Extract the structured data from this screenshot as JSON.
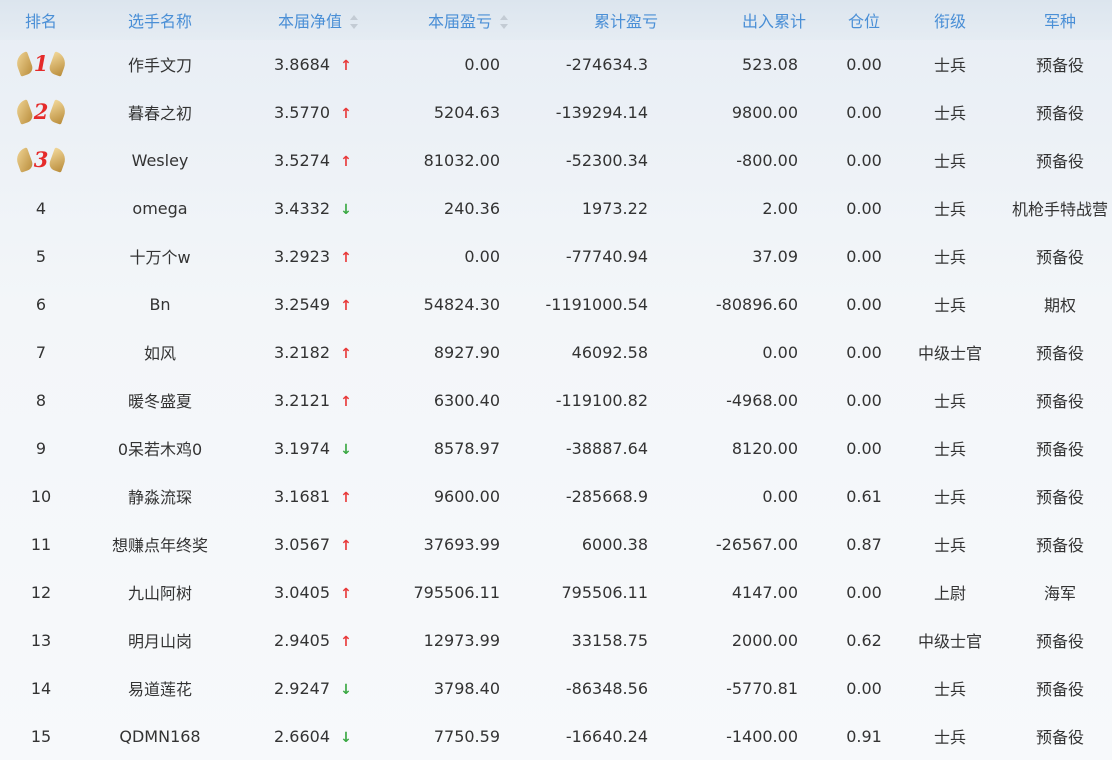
{
  "headers": {
    "rank": "排名",
    "name": "选手名称",
    "nav": "本届净值",
    "pnl": "本届盈亏",
    "cum_pnl": "累计盈亏",
    "flow": "出入累计",
    "position": "仓位",
    "title": "衔级",
    "branch": "军种"
  },
  "colors": {
    "header_text": "#4a8fd6",
    "up_arrow": "#e83a3a",
    "down_arrow": "#3aa843",
    "medal_number": "#e52b2b"
  },
  "rows": [
    {
      "rank": "1",
      "medal": true,
      "name": "作手文刀",
      "nav": "3.8684",
      "trend": "up",
      "pnl": "0.00",
      "cum_pnl": "-274634.3",
      "flow": "523.08",
      "position": "0.00",
      "title": "士兵",
      "branch": "预备役"
    },
    {
      "rank": "2",
      "medal": true,
      "name": "暮春之初",
      "nav": "3.5770",
      "trend": "up",
      "pnl": "5204.63",
      "cum_pnl": "-139294.14",
      "flow": "9800.00",
      "position": "0.00",
      "title": "士兵",
      "branch": "预备役"
    },
    {
      "rank": "3",
      "medal": true,
      "name": "Wesley",
      "nav": "3.5274",
      "trend": "up",
      "pnl": "81032.00",
      "cum_pnl": "-52300.34",
      "flow": "-800.00",
      "position": "0.00",
      "title": "士兵",
      "branch": "预备役"
    },
    {
      "rank": "4",
      "medal": false,
      "name": "omega",
      "nav": "3.4332",
      "trend": "down",
      "pnl": "240.36",
      "cum_pnl": "1973.22",
      "flow": "2.00",
      "position": "0.00",
      "title": "士兵",
      "branch": "机枪手特战营"
    },
    {
      "rank": "5",
      "medal": false,
      "name": "十万个w",
      "nav": "3.2923",
      "trend": "up",
      "pnl": "0.00",
      "cum_pnl": "-77740.94",
      "flow": "37.09",
      "position": "0.00",
      "title": "士兵",
      "branch": "预备役"
    },
    {
      "rank": "6",
      "medal": false,
      "name": "Bn",
      "nav": "3.2549",
      "trend": "up",
      "pnl": "54824.30",
      "cum_pnl": "-1191000.54",
      "flow": "-80896.60",
      "position": "0.00",
      "title": "士兵",
      "branch": "期权"
    },
    {
      "rank": "7",
      "medal": false,
      "name": "如风",
      "nav": "3.2182",
      "trend": "up",
      "pnl": "8927.90",
      "cum_pnl": "46092.58",
      "flow": "0.00",
      "position": "0.00",
      "title": "中级士官",
      "branch": "预备役"
    },
    {
      "rank": "8",
      "medal": false,
      "name": "暖冬盛夏",
      "nav": "3.2121",
      "trend": "up",
      "pnl": "6300.40",
      "cum_pnl": "-119100.82",
      "flow": "-4968.00",
      "position": "0.00",
      "title": "士兵",
      "branch": "预备役"
    },
    {
      "rank": "9",
      "medal": false,
      "name": "0呆若木鸡0",
      "nav": "3.1974",
      "trend": "down",
      "pnl": "8578.97",
      "cum_pnl": "-38887.64",
      "flow": "8120.00",
      "position": "0.00",
      "title": "士兵",
      "branch": "预备役"
    },
    {
      "rank": "10",
      "medal": false,
      "name": "静淼流琛",
      "nav": "3.1681",
      "trend": "up",
      "pnl": "9600.00",
      "cum_pnl": "-285668.9",
      "flow": "0.00",
      "position": "0.61",
      "title": "士兵",
      "branch": "预备役"
    },
    {
      "rank": "11",
      "medal": false,
      "name": "想赚点年终奖",
      "nav": "3.0567",
      "trend": "up",
      "pnl": "37693.99",
      "cum_pnl": "6000.38",
      "flow": "-26567.00",
      "position": "0.87",
      "title": "士兵",
      "branch": "预备役"
    },
    {
      "rank": "12",
      "medal": false,
      "name": "九山阿树",
      "nav": "3.0405",
      "trend": "up",
      "pnl": "795506.11",
      "cum_pnl": "795506.11",
      "flow": "4147.00",
      "position": "0.00",
      "title": "上尉",
      "branch": "海军"
    },
    {
      "rank": "13",
      "medal": false,
      "name": "明月山岗",
      "nav": "2.9405",
      "trend": "up",
      "pnl": "12973.99",
      "cum_pnl": "33158.75",
      "flow": "2000.00",
      "position": "0.62",
      "title": "中级士官",
      "branch": "预备役"
    },
    {
      "rank": "14",
      "medal": false,
      "name": "易道莲花",
      "nav": "2.9247",
      "trend": "down",
      "pnl": "3798.40",
      "cum_pnl": "-86348.56",
      "flow": "-5770.81",
      "position": "0.00",
      "title": "士兵",
      "branch": "预备役"
    },
    {
      "rank": "15",
      "medal": false,
      "name": "QDMN168",
      "nav": "2.6604",
      "trend": "down",
      "pnl": "7750.59",
      "cum_pnl": "-16640.24",
      "flow": "-1400.00",
      "position": "0.91",
      "title": "士兵",
      "branch": "预备役"
    }
  ]
}
